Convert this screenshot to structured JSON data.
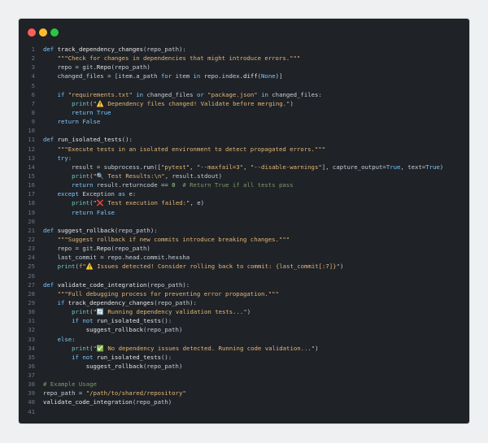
{
  "window": {
    "controls": [
      "close",
      "minimize",
      "maximize"
    ]
  },
  "code": {
    "language": "python",
    "lines": [
      {
        "n": 1,
        "text": "def track_dependency_changes(repo_path):"
      },
      {
        "n": 2,
        "text": "    \"\"\"Check for changes in dependencies that might introduce errors.\"\"\""
      },
      {
        "n": 3,
        "text": "    repo = git.Repo(repo_path)"
      },
      {
        "n": 4,
        "text": "    changed_files = [item.a_path for item in repo.index.diff(None)]"
      },
      {
        "n": 5,
        "text": ""
      },
      {
        "n": 6,
        "text": "    if \"requirements.txt\" in changed_files or \"package.json\" in changed_files:"
      },
      {
        "n": 7,
        "text": "        print(\"⚠️ Dependency files changed! Validate before merging.\")"
      },
      {
        "n": 8,
        "text": "        return True"
      },
      {
        "n": 9,
        "text": "    return False"
      },
      {
        "n": 10,
        "text": ""
      },
      {
        "n": 11,
        "text": "def run_isolated_tests():"
      },
      {
        "n": 12,
        "text": "    \"\"\"Execute tests in an isolated environment to detect propagated errors.\"\"\""
      },
      {
        "n": 13,
        "text": "    try:"
      },
      {
        "n": 14,
        "text": "        result = subprocess.run([\"pytest\", \"--maxfail=3\", \"--disable-warnings\"], capture_output=True, text=True)"
      },
      {
        "n": 15,
        "text": "        print(\"🔍 Test Results:\\n\", result.stdout)"
      },
      {
        "n": 16,
        "text": "        return result.returncode == 0  # Return True if all tests pass"
      },
      {
        "n": 17,
        "text": "    except Exception as e:"
      },
      {
        "n": 18,
        "text": "        print(\"❌ Test execution failed:\", e)"
      },
      {
        "n": 19,
        "text": "        return False"
      },
      {
        "n": 20,
        "text": ""
      },
      {
        "n": 21,
        "text": "def suggest_rollback(repo_path):"
      },
      {
        "n": 22,
        "text": "    \"\"\"Suggest rollback if new commits introduce breaking changes.\"\"\""
      },
      {
        "n": 23,
        "text": "    repo = git.Repo(repo_path)"
      },
      {
        "n": 24,
        "text": "    last_commit = repo.head.commit.hexsha"
      },
      {
        "n": 25,
        "text": "    print(f\"⚠️ Issues detected! Consider rolling back to commit: {last_commit[:7]}\")"
      },
      {
        "n": 26,
        "text": ""
      },
      {
        "n": 27,
        "text": "def validate_code_integration(repo_path):"
      },
      {
        "n": 28,
        "text": "    \"\"\"Full debugging process for preventing error propagation.\"\"\""
      },
      {
        "n": 29,
        "text": "    if track_dependency_changes(repo_path):"
      },
      {
        "n": 30,
        "text": "        print(\"🔄 Running dependency validation tests...\")"
      },
      {
        "n": 31,
        "text": "        if not run_isolated_tests():"
      },
      {
        "n": 32,
        "text": "            suggest_rollback(repo_path)"
      },
      {
        "n": 33,
        "text": "    else:"
      },
      {
        "n": 34,
        "text": "        print(\"✅ No dependency issues detected. Running code validation...\")"
      },
      {
        "n": 35,
        "text": "        if not run_isolated_tests():"
      },
      {
        "n": 36,
        "text": "            suggest_rollback(repo_path)"
      },
      {
        "n": 37,
        "text": ""
      },
      {
        "n": 38,
        "text": "# Example Usage"
      },
      {
        "n": 39,
        "text": "repo_path = \"/path/to/shared/repository\""
      },
      {
        "n": 40,
        "text": "validate_code_integration(repo_path)"
      },
      {
        "n": 41,
        "text": ""
      }
    ]
  }
}
